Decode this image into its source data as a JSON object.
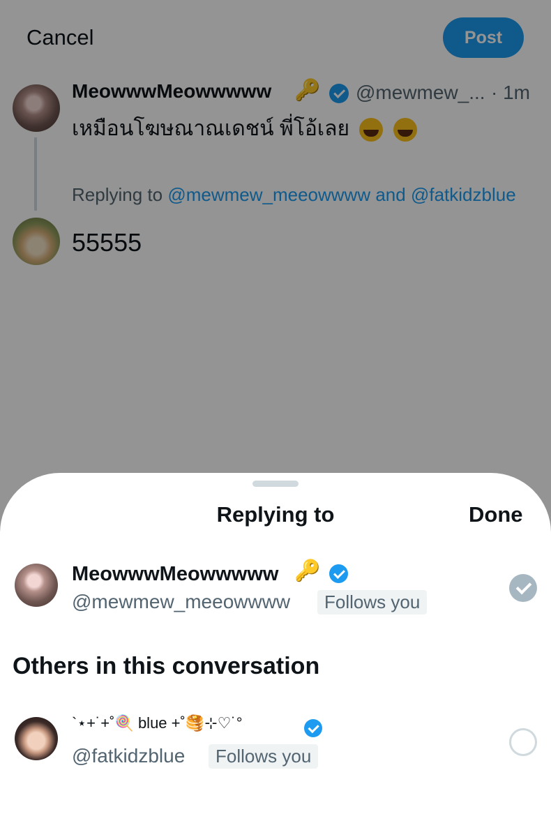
{
  "compose": {
    "cancel_label": "Cancel",
    "post_label": "Post",
    "original_tweet": {
      "display_name": "MeowwwMeowwwww",
      "name_emoji": "🔑",
      "handle": "@mewmew_...",
      "separator_time": "· 1m",
      "text": "เหมือนโฆษณาณเดชน์ พี่โอ้เลย",
      "emojis": [
        "grinning-squinting-face",
        "grinning-squinting-face"
      ]
    },
    "replying_prefix": "Replying to",
    "replying_user1": "@mewmew_meeowwww",
    "replying_and": "and",
    "replying_user2": "@fatkidzblue",
    "reply_text": "55555"
  },
  "sheet": {
    "title": "Replying to",
    "done_label": "Done",
    "primary_user": {
      "display_name": "MeowwwMeowwwww",
      "name_emoji": "🔑",
      "handle": "@mewmew_meeowwww",
      "follows_label": "Follows you",
      "selected": true
    },
    "others_heading": "Others in this conversation",
    "other_user": {
      "display_name": "`⋆+˙+˚🍭 blue +˚🥞⊹♡˙°",
      "handle": "@fatkidzblue",
      "follows_label": "Follows you",
      "selected": false
    }
  },
  "colors": {
    "accent": "#1d9bf0",
    "verified": "#1d9bf0",
    "secondary_text": "#536471"
  }
}
